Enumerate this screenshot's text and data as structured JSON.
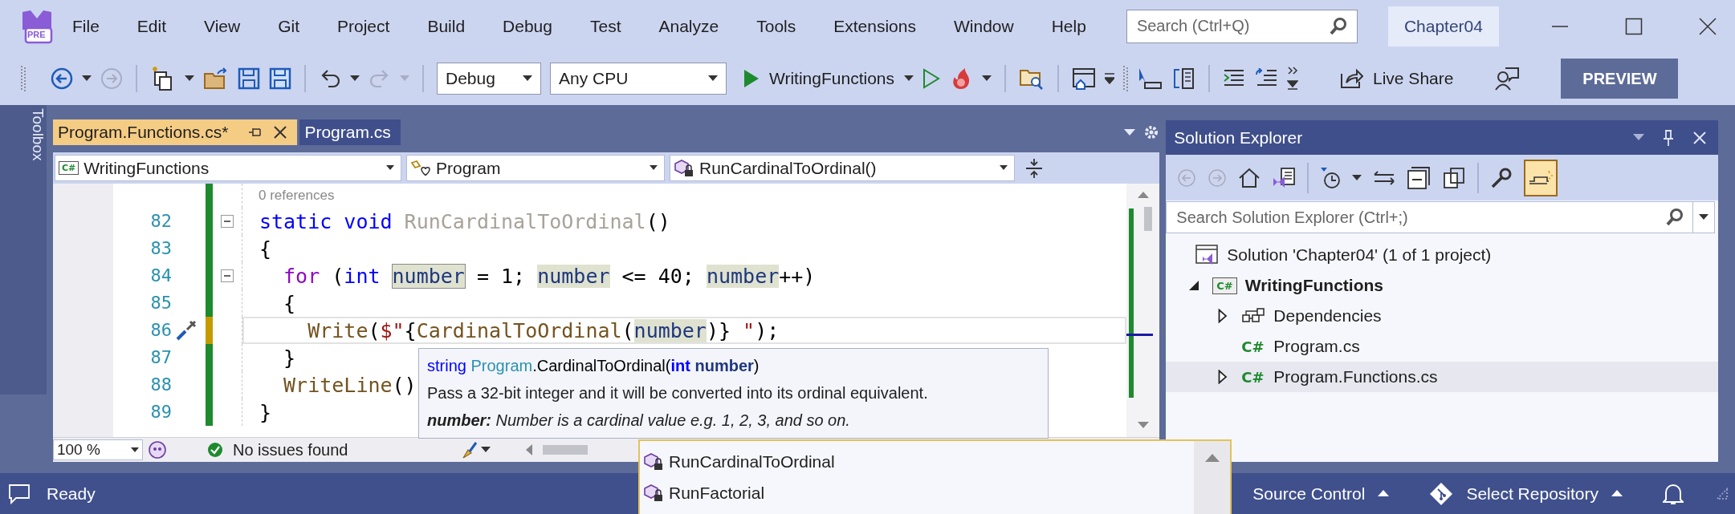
{
  "title_bar": {
    "logo_badge": "PRE",
    "menu": [
      "File",
      "Edit",
      "View",
      "Git",
      "Project",
      "Build",
      "Debug",
      "Test",
      "Analyze",
      "Tools",
      "Extensions",
      "Window",
      "Help"
    ],
    "search": {
      "placeholder": "Search (Ctrl+Q)"
    },
    "solution_name": "Chapter04"
  },
  "toolbar": {
    "configuration": "Debug",
    "platform": "Any CPU",
    "startup_project": "WritingFunctions",
    "live_share": "Live Share",
    "preview": "PREVIEW"
  },
  "toolbox": {
    "label": "Toolbox"
  },
  "editor": {
    "tabs": [
      {
        "label": "Program.Functions.cs*",
        "selected": true
      },
      {
        "label": "Program.cs",
        "selected": false
      }
    ],
    "nav": {
      "project_badge": "C#",
      "project": "WritingFunctions",
      "type": "Program",
      "member": "RunCardinalToOrdinal()"
    },
    "codelens": "0 references",
    "lines": [
      {
        "number": "82",
        "fold": true,
        "unsaved": false,
        "current": false,
        "quick_action": false,
        "tokens": [
          {
            "text": "static void ",
            "kind": "keyword"
          },
          {
            "text": "RunCardinalToOrdinal",
            "kind": "dimmed"
          },
          {
            "text": "()",
            "kind": "plain"
          }
        ]
      },
      {
        "number": "83",
        "fold": false,
        "unsaved": false,
        "current": false,
        "quick_action": false,
        "tokens": [
          {
            "text": "{",
            "kind": "plain"
          }
        ]
      },
      {
        "number": "84",
        "fold": true,
        "unsaved": false,
        "current": false,
        "quick_action": false,
        "tokens": [
          {
            "text": "  for",
            "kind": "control"
          },
          {
            "text": " (",
            "kind": "plain"
          },
          {
            "text": "int ",
            "kind": "keyword"
          },
          {
            "text": "number",
            "kind": "local-definition"
          },
          {
            "text": " = 1; ",
            "kind": "plain"
          },
          {
            "text": "number",
            "kind": "local-reference"
          },
          {
            "text": " <= 40; ",
            "kind": "plain"
          },
          {
            "text": "number",
            "kind": "local-reference"
          },
          {
            "text": "++)",
            "kind": "plain"
          }
        ]
      },
      {
        "number": "85",
        "fold": false,
        "unsaved": false,
        "current": false,
        "quick_action": false,
        "tokens": [
          {
            "text": "  {",
            "kind": "plain"
          }
        ]
      },
      {
        "number": "86",
        "fold": false,
        "unsaved": true,
        "current": true,
        "quick_action": true,
        "tokens": [
          {
            "text": "    Write",
            "kind": "method"
          },
          {
            "text": "(",
            "kind": "plain"
          },
          {
            "text": "$\"",
            "kind": "string"
          },
          {
            "text": "{",
            "kind": "plain"
          },
          {
            "text": "CardinalToOrdinal",
            "kind": "method"
          },
          {
            "text": "(",
            "kind": "plain"
          },
          {
            "text": "number",
            "kind": "local-reference"
          },
          {
            "text": ")}",
            "kind": "plain"
          },
          {
            "text": " \"",
            "kind": "string"
          },
          {
            "text": ");",
            "kind": "plain"
          }
        ]
      },
      {
        "number": "87",
        "fold": false,
        "unsaved": false,
        "current": false,
        "quick_action": false,
        "tokens": [
          {
            "text": "  }",
            "kind": "plain"
          }
        ]
      },
      {
        "number": "88",
        "fold": false,
        "unsaved": false,
        "current": false,
        "quick_action": false,
        "tokens": [
          {
            "text": "  WriteLine",
            "kind": "method"
          },
          {
            "text": "()",
            "kind": "plain"
          }
        ]
      },
      {
        "number": "89",
        "fold": false,
        "unsaved": false,
        "current": false,
        "quick_action": false,
        "tokens": [
          {
            "text": "}",
            "kind": "plain"
          }
        ]
      }
    ],
    "tooltip": {
      "signature": [
        {
          "text": "string ",
          "kind": "keyword"
        },
        {
          "text": "Program",
          "kind": "type"
        },
        {
          "text": ".CardinalToOrdinal(",
          "kind": "plain"
        },
        {
          "text": "int",
          "kind": "keyword-bold"
        },
        {
          "text": " number",
          "kind": "param"
        },
        {
          "text": ")",
          "kind": "plain"
        }
      ],
      "summary": "Pass a 32-bit integer and it will be converted into its ordinal equivalent.",
      "param": "**number:**  Number is a cardinal value e.g. 1, 2, 3, and so on."
    },
    "zoom": "100 %",
    "issues": "No issues found",
    "completion": [
      {
        "label": "RunCardinalToOrdinal"
      },
      {
        "label": "RunFactorial"
      }
    ]
  },
  "solution_explorer": {
    "title": "Solution Explorer",
    "preview_toggle_on": true,
    "search": {
      "placeholder": "Search Solution Explorer (Ctrl+;)"
    },
    "tree": [
      {
        "label": "Solution 'Chapter04' (1 of 1 project)",
        "kind": "solution",
        "selected": false,
        "startup": false,
        "children": [
          {
            "label": "WritingFunctions",
            "kind": "project",
            "badge": "C#",
            "expanded": true,
            "selected": false,
            "startup": true,
            "children": [
              {
                "label": "Dependencies",
                "kind": "dependencies",
                "expanded": false,
                "selected": false,
                "startup": false
              },
              {
                "label": "Program.cs",
                "kind": "csfile",
                "badge": "C#",
                "selected": false,
                "startup": false
              },
              {
                "label": "Program.Functions.cs",
                "kind": "csfile",
                "badge": "C#",
                "expanded": false,
                "selected": true,
                "startup": false
              }
            ]
          }
        ]
      }
    ]
  },
  "status_bar": {
    "message": "Ready",
    "source_control": "Source Control",
    "repository": "Select Repository"
  }
}
